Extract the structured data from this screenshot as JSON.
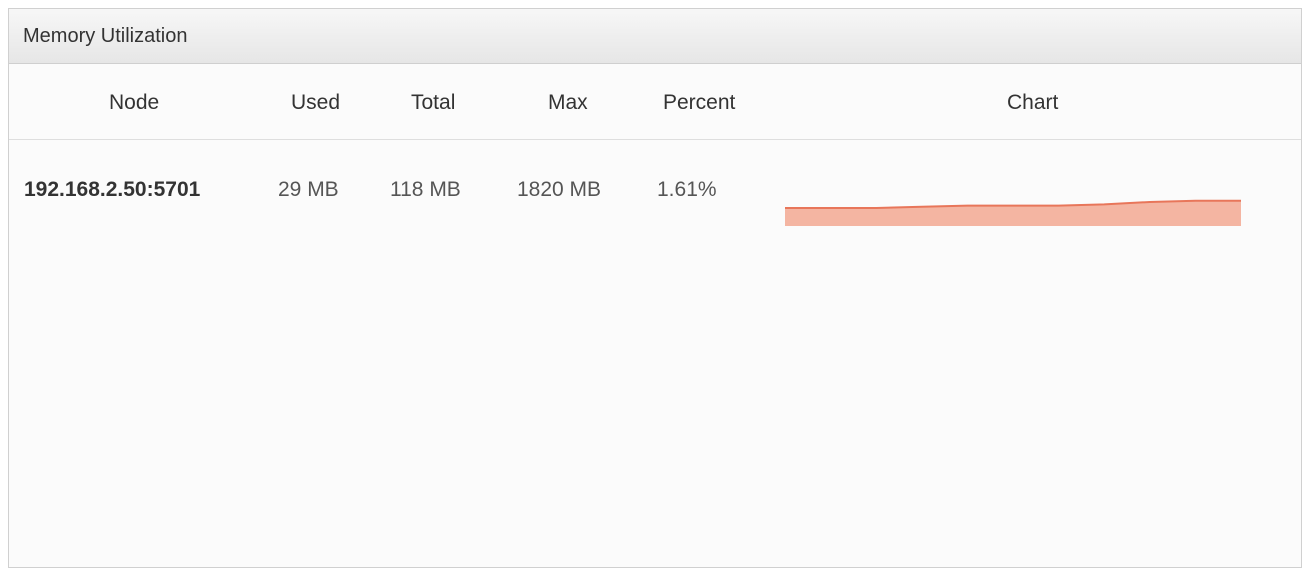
{
  "panel": {
    "title": "Memory Utilization"
  },
  "columns": {
    "node": "Node",
    "used": "Used",
    "total": "Total",
    "max": "Max",
    "percent": "Percent",
    "chart": "Chart"
  },
  "rows": [
    {
      "node": "192.168.2.50:5701",
      "used": "29 MB",
      "total": "118 MB",
      "max": "1820 MB",
      "percent": "1.61%"
    }
  ],
  "colors": {
    "sparkline_line": "#e8765a",
    "sparkline_fill": "#f4b5a2"
  },
  "chart_data": {
    "type": "area",
    "series": [
      {
        "values": [
          1.55,
          1.55,
          1.55,
          1.56,
          1.57,
          1.57,
          1.57,
          1.58,
          1.6,
          1.61,
          1.61
        ]
      }
    ]
  }
}
